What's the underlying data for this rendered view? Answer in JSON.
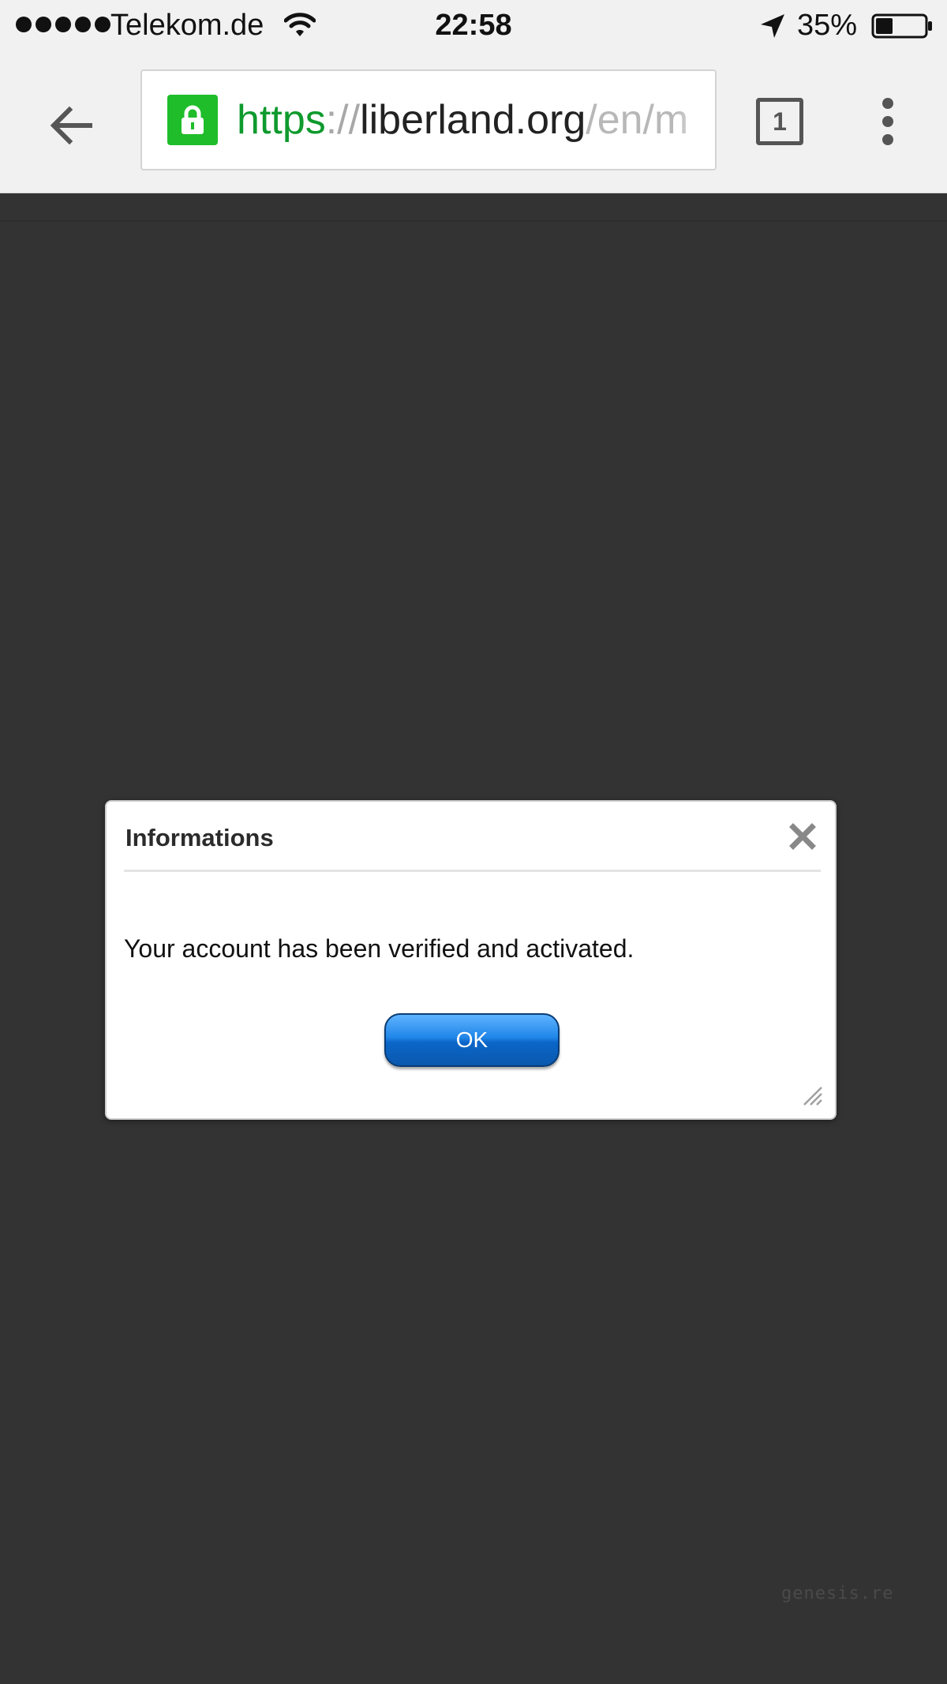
{
  "status_bar": {
    "carrier": "Telekom.de",
    "time": "22:58",
    "battery_percent": "35%",
    "battery_level": 0.35,
    "signal_bars": 5,
    "icons": [
      "wifi-icon",
      "location-arrow-icon",
      "battery-icon"
    ]
  },
  "toolbar": {
    "url": {
      "scheme": "https",
      "separator": "://",
      "host": "liberland.org",
      "path": "/en/m"
    },
    "tab_count": "1",
    "icons": [
      "back-arrow-icon",
      "lock-icon",
      "tab-switcher-icon",
      "overflow-menu-icon"
    ],
    "colors": {
      "lock_badge": "#1fbd2a",
      "scheme_text": "#0e9a2d"
    }
  },
  "dialog": {
    "title": "Informations",
    "message": "Your account has been verified and activated.",
    "ok_label": "OK",
    "icons": [
      "close-icon",
      "resize-handle-icon"
    ],
    "colors": {
      "ok_button": "#1f86e8"
    }
  },
  "page": {
    "overlay_color": "#333333"
  },
  "watermark": "genesis.re"
}
